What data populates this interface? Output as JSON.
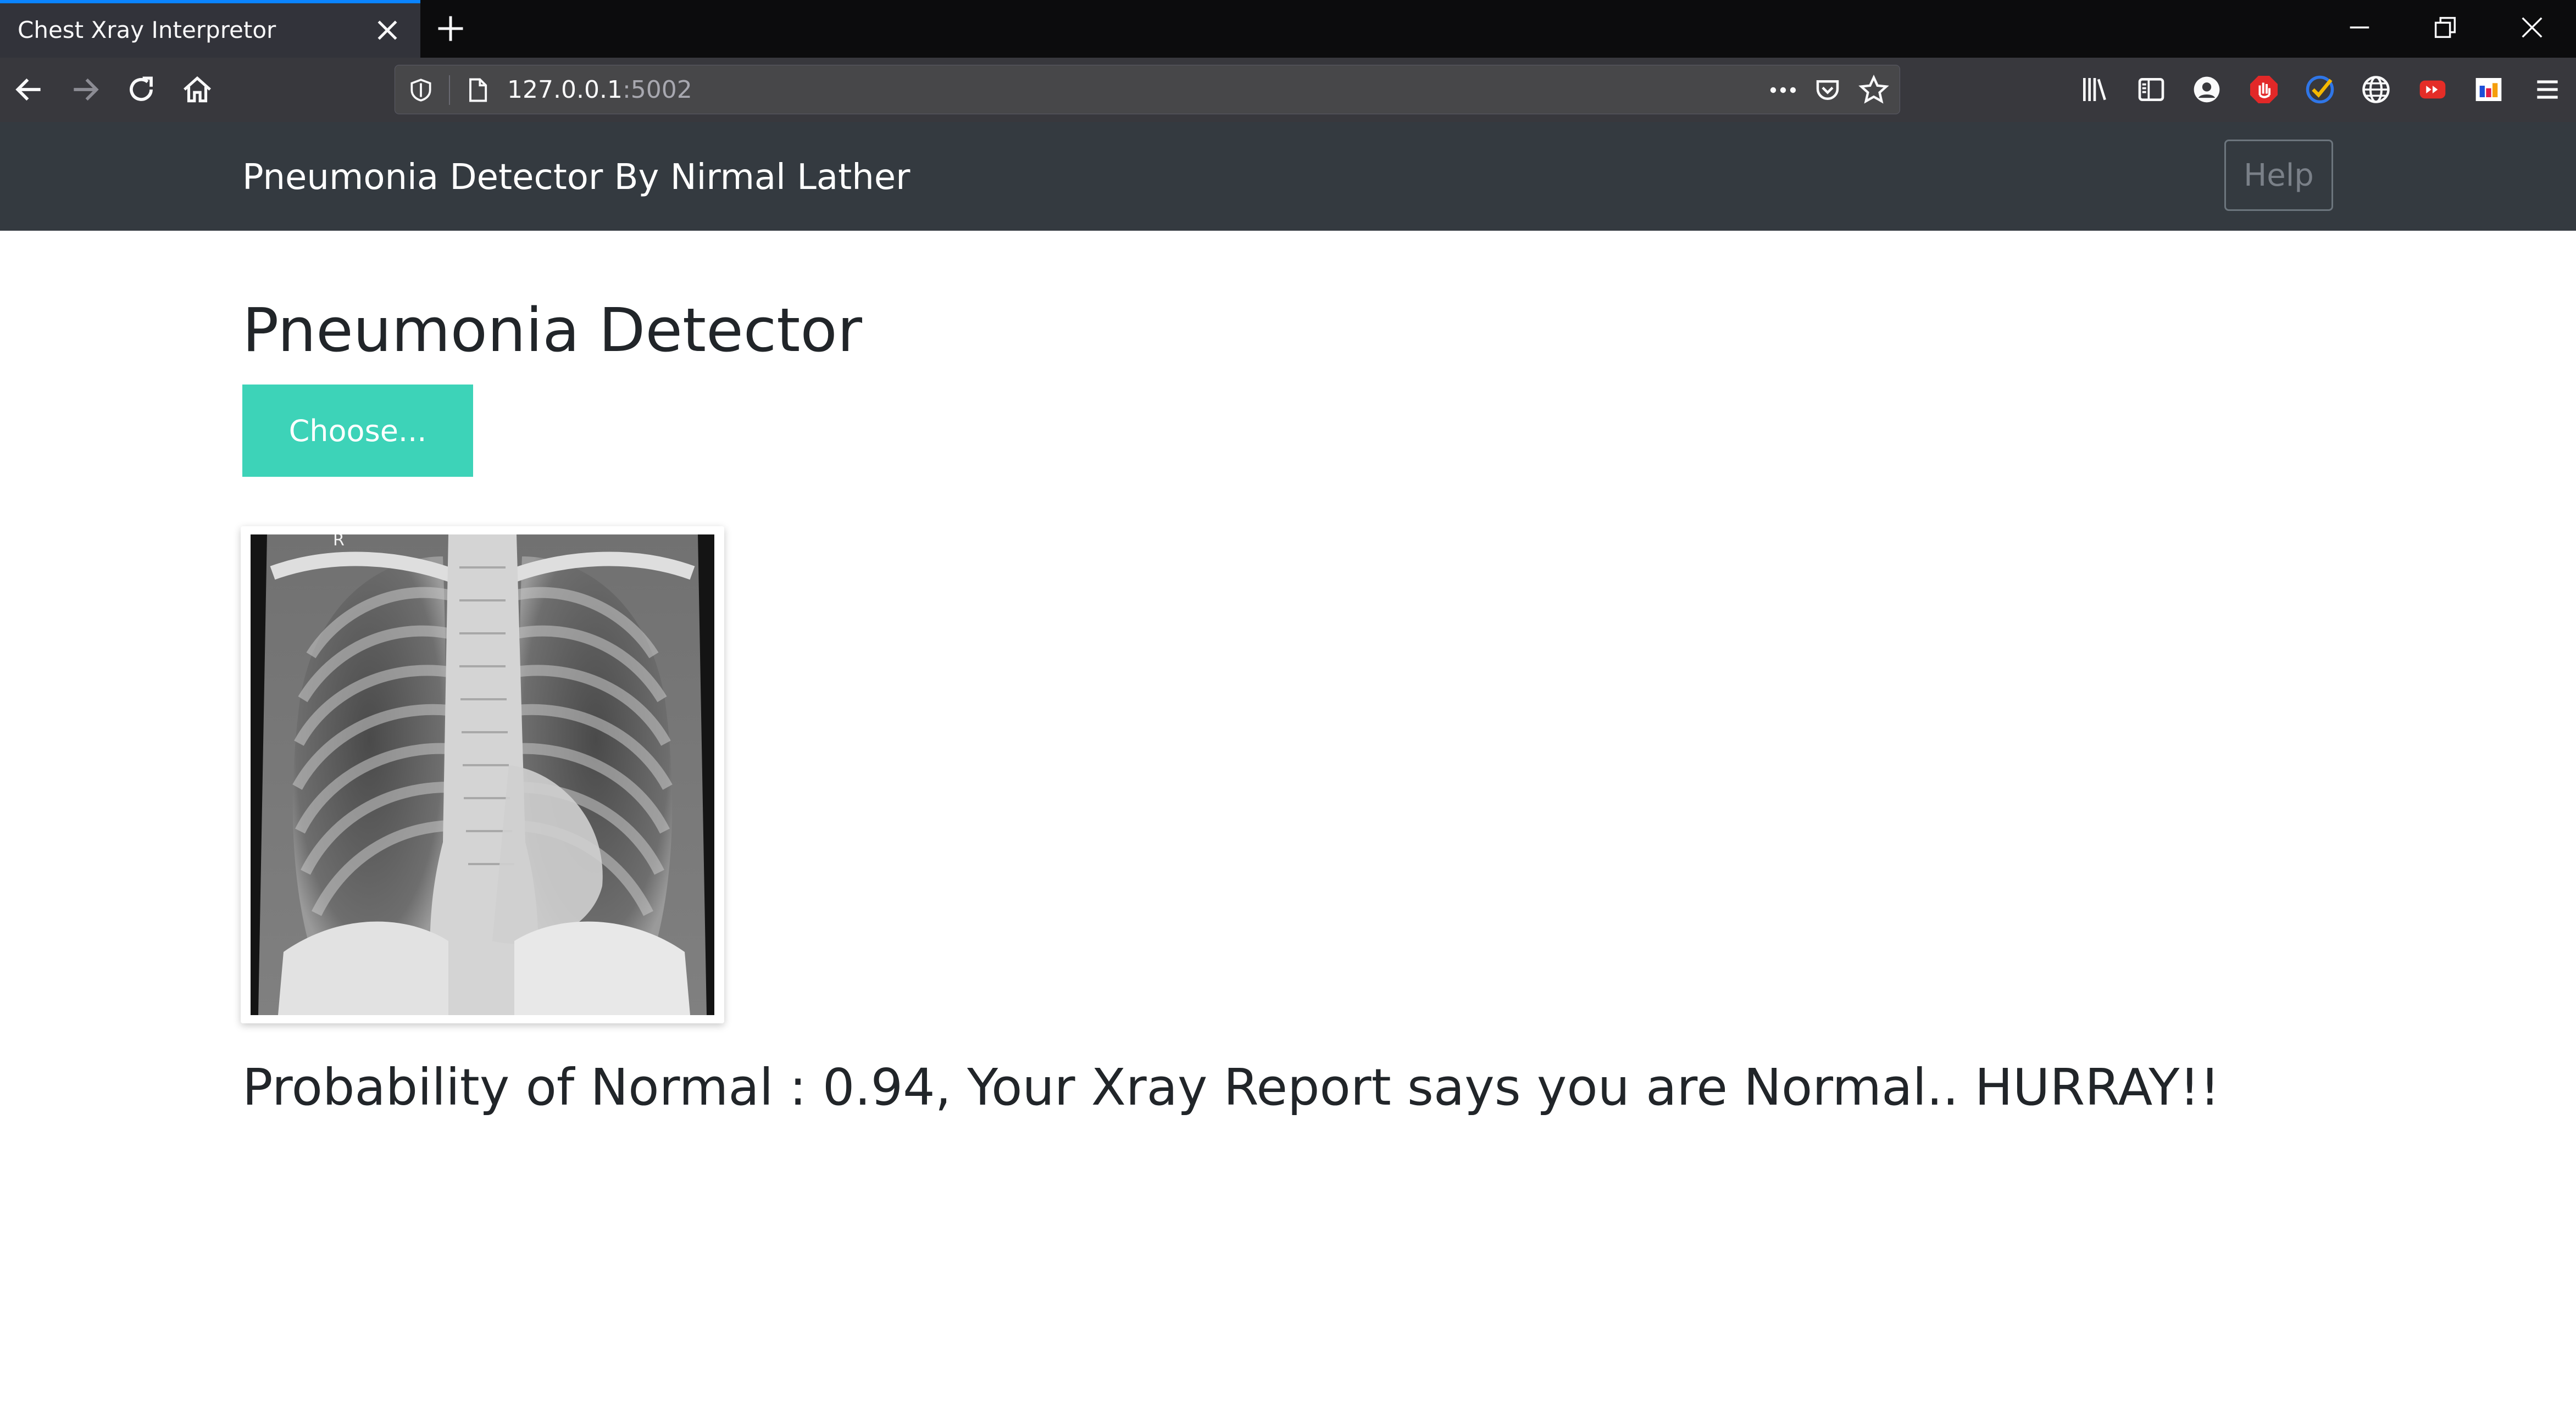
{
  "browser": {
    "tab_title": "Chest Xray Interpretor",
    "url_host": "127.0.0.1",
    "url_port": ":5002"
  },
  "header": {
    "brand": "Pneumonia Detector By Nirmal Lather",
    "help_label": "Help"
  },
  "main": {
    "title": "Pneumonia Detector",
    "choose_label": "Choose...",
    "xray_marker": "R",
    "result_text": "Probability of Normal : 0.94, Your Xray Report says you are Normal.. HURRAY!!"
  },
  "colors": {
    "accent": "#3dd3b8",
    "header_bg": "#343a40",
    "tab_highlight": "#0a84ff"
  },
  "icons": [
    "close-icon",
    "plus-icon",
    "minimize-icon",
    "restore-icon",
    "window-close-icon",
    "back-arrow-icon",
    "forward-arrow-icon",
    "reload-icon",
    "home-icon",
    "shield-icon",
    "page-icon",
    "more-icon",
    "pocket-icon",
    "star-icon",
    "library-icon",
    "sidebar-icon",
    "account-icon",
    "adblock-icon",
    "checkmark-extension-icon",
    "globe-icon",
    "video-extension-icon",
    "flag-extension-icon",
    "menu-icon"
  ]
}
